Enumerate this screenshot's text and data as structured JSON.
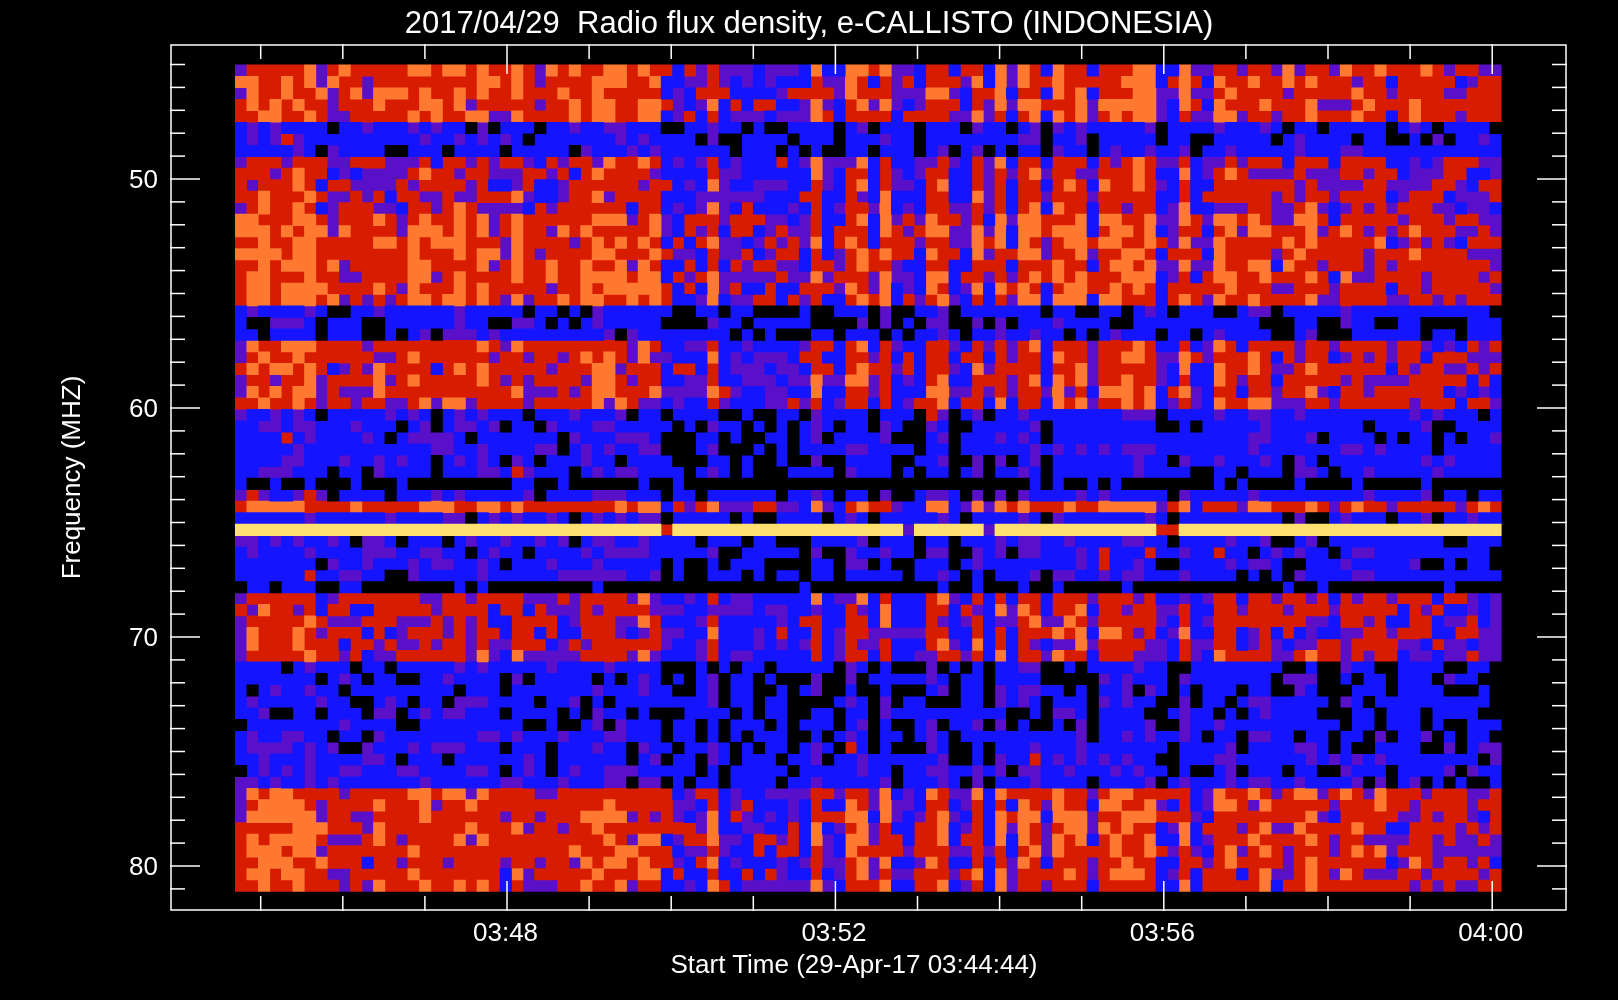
{
  "title": "2017/04/29  Radio flux density, e-CALLISTO (INDONESIA)",
  "y_axis": {
    "label": "Frequency (MHZ)",
    "ticks": [
      "50",
      "60",
      "70",
      "80"
    ]
  },
  "x_axis": {
    "label": "Start Time (29-Apr-17 03:44:44)",
    "ticks": [
      "03:48",
      "03:52",
      "03:56",
      "04:00"
    ]
  }
}
